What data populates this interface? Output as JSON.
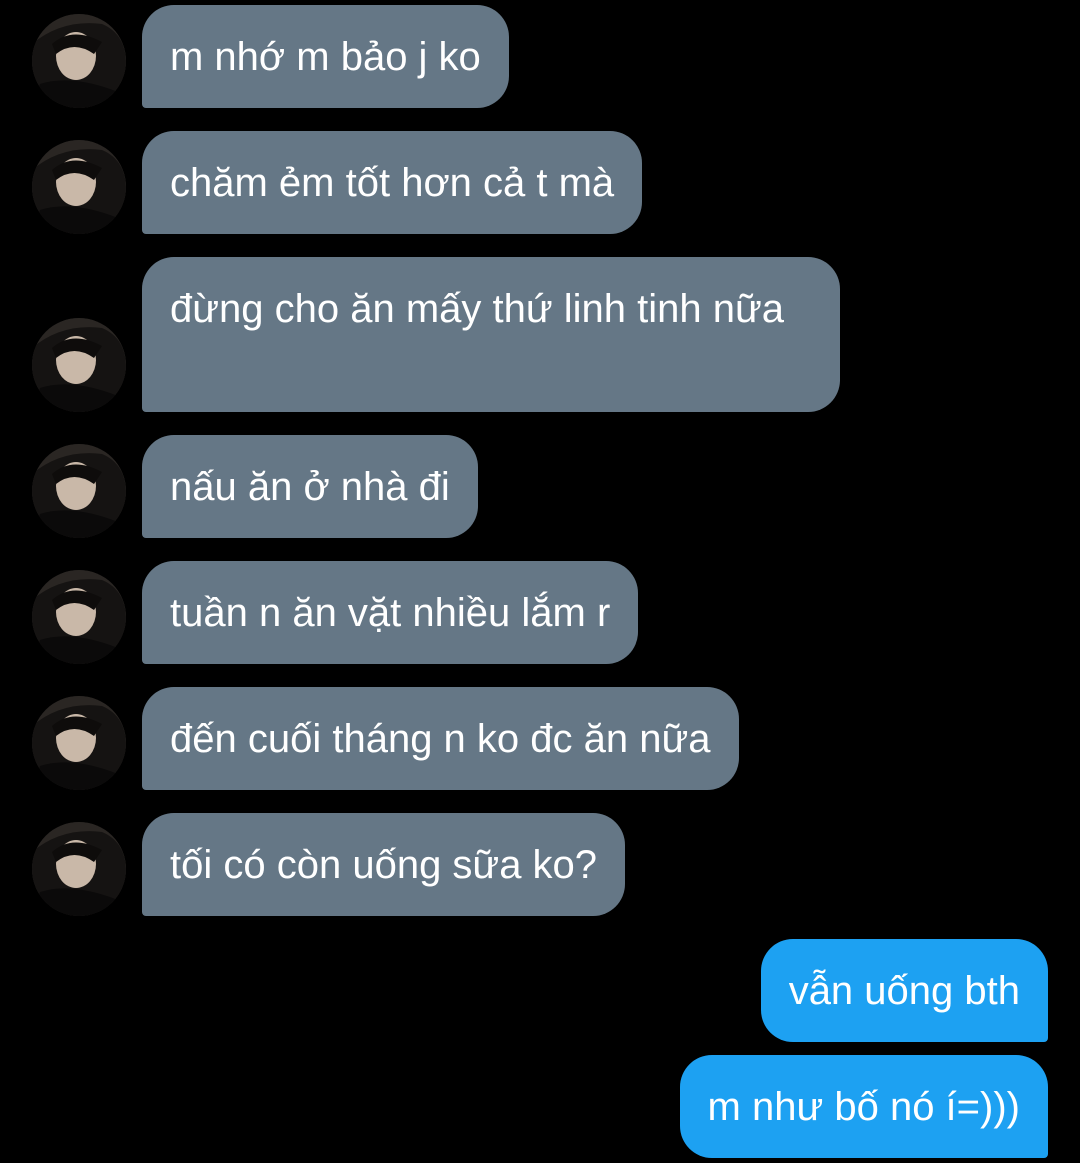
{
  "colors": {
    "background": "#000000",
    "incoming_bubble": "#657786",
    "outgoing_bubble": "#1da1f2",
    "text": "#ffffff"
  },
  "avatar_icon": "contact-avatar-photo",
  "messages": [
    {
      "direction": "in",
      "text": "m nhớ m bảo j ko"
    },
    {
      "direction": "in",
      "text": "chăm ẻm tốt hơn cả t mà"
    },
    {
      "direction": "in",
      "text": "đừng cho ăn mấy thứ linh tinh nữa"
    },
    {
      "direction": "in",
      "text": "nấu ăn ở nhà đi"
    },
    {
      "direction": "in",
      "text": "tuần n ăn vặt nhiều lắm r"
    },
    {
      "direction": "in",
      "text": "đến cuối tháng n ko đc ăn nữa"
    },
    {
      "direction": "in",
      "text": "tối có còn uống sữa ko?"
    },
    {
      "direction": "out",
      "text": "vẫn uống bth"
    },
    {
      "direction": "out",
      "text": "m như bố nó í=)))"
    }
  ]
}
